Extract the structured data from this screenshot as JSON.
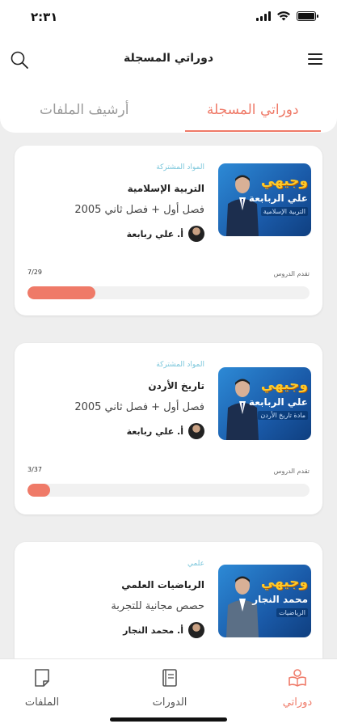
{
  "status": {
    "time": "٢:٣١"
  },
  "header": {
    "title": "دوراتي المسجلة"
  },
  "tabs": [
    {
      "label": "دوراتي المسجلة",
      "active": true
    },
    {
      "label": "أرشيف الملفات",
      "active": false
    }
  ],
  "courses": [
    {
      "material_label": "المواد المشتركة",
      "subject": "التربية الإسلامية",
      "period": "فصل أول + فصل ثاني 2005",
      "teacher": "أ. علي ربابعة",
      "thumb_brand": "وجيهي",
      "thumb_name": "علي الربابعة",
      "thumb_sub": "التربية الإسلامية",
      "progress_label": "تقدم الدروس",
      "progress_count": "7/29",
      "progress_fraction": 0.24
    },
    {
      "material_label": "المواد المشتركة",
      "subject": "تاريخ الأردن",
      "period": "فصل أول + فصل ثاني 2005",
      "teacher": "أ. علي ربابعة",
      "thumb_brand": "وجيهي",
      "thumb_name": "علي الربابعة",
      "thumb_sub": "مادة تاريخ الأردن",
      "progress_label": "تقدم الدروس",
      "progress_count": "3/37",
      "progress_fraction": 0.08
    },
    {
      "material_label": "علمي",
      "subject": "الرياضيات العلمي",
      "period": "حصص مجانية للتجربة",
      "teacher": "أ. محمد النجار",
      "thumb_brand": "وجيهي",
      "thumb_name": "محمد النجار",
      "thumb_sub": "الرياضيات"
    }
  ],
  "bottom_nav": [
    {
      "label": "دوراتي",
      "icon": "reader-icon",
      "active": true
    },
    {
      "label": "الدورات",
      "icon": "book-icon",
      "active": false
    },
    {
      "label": "الملفات",
      "icon": "file-icon",
      "active": false
    }
  ],
  "colors": {
    "accent": "#ef7a68",
    "material": "#7ac6db",
    "thumb_blue": "#1a5aa8"
  }
}
